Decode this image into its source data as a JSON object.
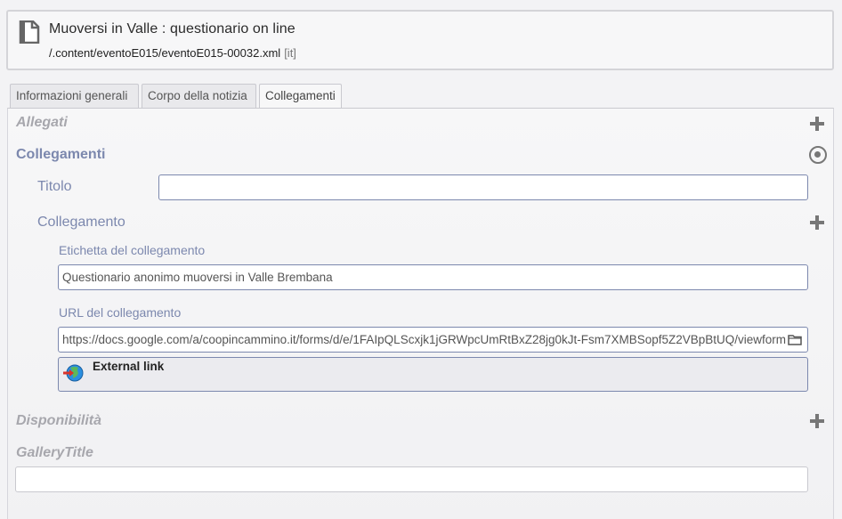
{
  "header": {
    "title": "Muoversi in Valle : questionario on line",
    "path": "/.content/eventoE015/eventoE015-00032.xml",
    "locale": "[it]",
    "icon": "document-icon"
  },
  "tabs": [
    {
      "label": "Informazioni generali",
      "active": false
    },
    {
      "label": "Corpo della notizia",
      "active": false
    },
    {
      "label": "Collegamenti",
      "active": true
    }
  ],
  "sections": {
    "allegati": {
      "label": "Allegati",
      "icon": "plus-icon"
    },
    "collegamenti": {
      "label": "Collegamenti",
      "icon": "target-icon"
    },
    "disponibilita": {
      "label": "Disponibilità",
      "icon": "plus-icon"
    },
    "gallery_title": {
      "label": "GalleryTitle",
      "value": ""
    }
  },
  "collegamenti": {
    "titolo": {
      "label": "Titolo",
      "value": ""
    },
    "collegamento": {
      "label": "Collegamento",
      "icon": "plus-icon",
      "etichetta": {
        "label": "Etichetta del collegamento",
        "value": "Questionario anonimo muoversi in Valle Brembana"
      },
      "url": {
        "label": "URL del collegamento",
        "value": "https://docs.google.com/a/coopincammino.it/forms/d/e/1FAIpQLScxjk1jGRWpcUmRtBxZ28jg0kJt-Fsm7XMBSopf5Z2VBpBtUQ/viewform"
      },
      "link_type": {
        "label": "External link",
        "icon": "globe-link-icon"
      }
    }
  }
}
